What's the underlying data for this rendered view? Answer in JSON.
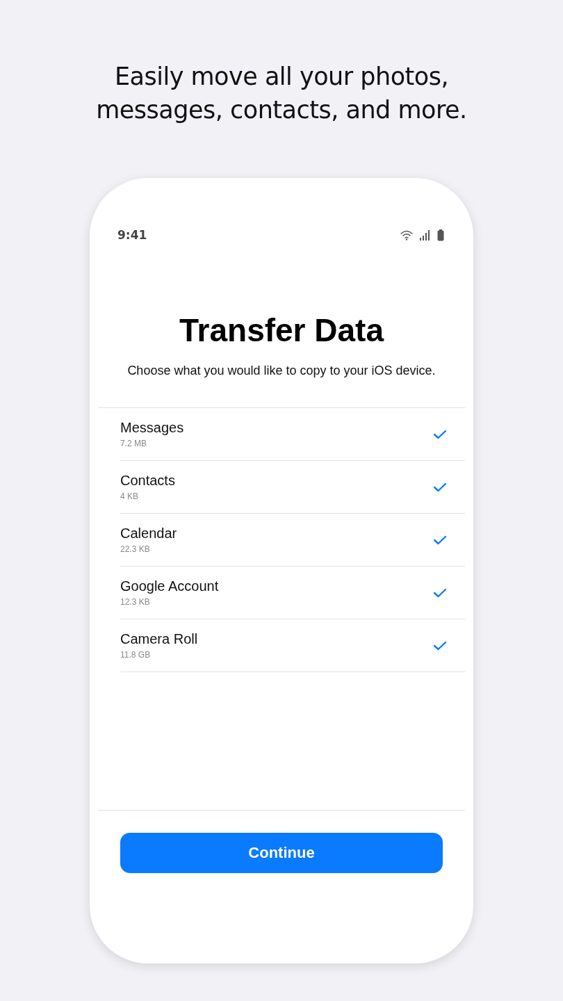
{
  "headline": "Easily move all your photos, messages, contacts, and more.",
  "status_bar": {
    "time": "9:41"
  },
  "title": "Transfer Data",
  "subtitle": "Choose what you would like to copy to your iOS device.",
  "items": [
    {
      "label": "Messages",
      "size": "7.2 MB",
      "checked": true
    },
    {
      "label": "Contacts",
      "size": "4 KB",
      "checked": true
    },
    {
      "label": "Calendar",
      "size": "22.3 KB",
      "checked": true
    },
    {
      "label": "Google Account",
      "size": "12.3 KB",
      "checked": true
    },
    {
      "label": "Camera Roll",
      "size": "11.8 GB",
      "checked": true
    }
  ],
  "button": "Continue"
}
